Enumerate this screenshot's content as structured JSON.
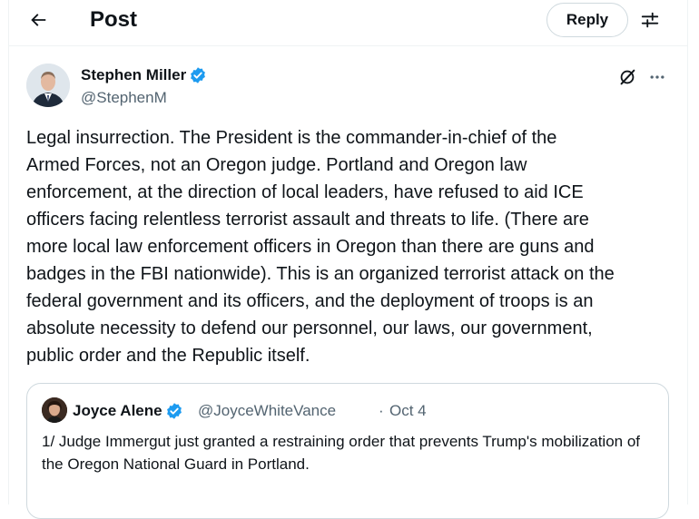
{
  "header": {
    "title": "Post",
    "reply_label": "Reply",
    "back_icon": "arrow-left-icon",
    "settings_icon": "sliders-icon"
  },
  "author": {
    "name": "Stephen Miller",
    "handle": "@StephenM",
    "verified": true
  },
  "post": {
    "text": "Legal insurrection. The President is the commander-in-chief of the\nArmed Forces, not an Oregon judge. Portland and Oregon law\nenforcement, at the direction of local leaders, have refused to aid ICE\nofficers facing relentless terrorist assault and threats to life. (There are\nmore local law enforcement officers in Oregon than there are guns and\nbadges in the FBI nationwide). This is an organized terrorist attack on the\nfederal government and its officers, and the deployment of troops is an\nabsolute necessity to defend our personnel, our laws, our government,\npublic order and the Republic itself."
  },
  "quote": {
    "name": "Joyce Alene",
    "handle": "@JoyceWhiteVance",
    "separator": "·",
    "date": "Oct 4",
    "text": "1/ Judge Immergut just granted a restraining order that prevents Trump's mobilization of the Oregon National Guard in Portland."
  },
  "colors": {
    "verified_blue": "#1d9bf0",
    "secondary_text": "#536471",
    "border": "#cfd9de"
  }
}
